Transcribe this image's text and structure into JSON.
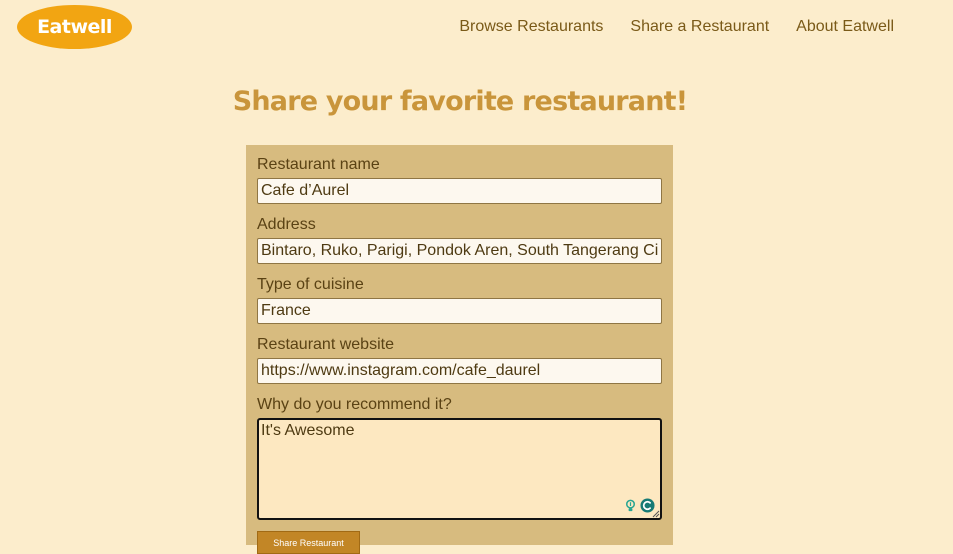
{
  "brand": {
    "logo_text": "Eatwell",
    "logo_color": "#f2a512"
  },
  "nav": {
    "items": [
      {
        "label": "Browse Restaurants"
      },
      {
        "label": "Share a Restaurant"
      },
      {
        "label": "About Eatwell"
      }
    ]
  },
  "page": {
    "title": "Share your favorite restaurant!",
    "background": "#fcedcc",
    "accent": "#c9953b"
  },
  "form": {
    "background": "#d7bb7f",
    "fields": {
      "name": {
        "label": "Restaurant name",
        "value": "Cafe d’Aurel"
      },
      "address": {
        "label": "Address",
        "value": "Bintaro, Ruko, Parigi, Pondok Aren, South Tangerang City"
      },
      "cuisine": {
        "label": "Type of cuisine",
        "value": "France"
      },
      "website": {
        "label": "Restaurant website",
        "value": "https://www.instagram.com/cafe_daurel"
      },
      "reason": {
        "label": "Why do you recommend it?",
        "value": "It's Awesome"
      }
    },
    "extension_icons": [
      "bulb-icon",
      "grammar-check-icon"
    ],
    "submit_label": "Share Restaurant",
    "submit_color": "#c28626"
  }
}
